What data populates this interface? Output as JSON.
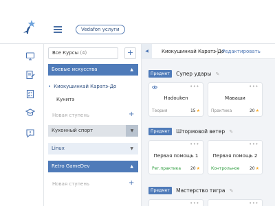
{
  "header": {
    "service_button": "Vedafon услуги"
  },
  "rail": {
    "icons": [
      "monitor-icon",
      "edit-document-icon",
      "checklist-icon",
      "graduation-cap-icon",
      "alert-message-icon"
    ]
  },
  "courses": {
    "search_label": "Все Курсы",
    "search_count": "(4)",
    "add_label": "+",
    "groups": [
      {
        "label": "Боевые искусства",
        "state": "active",
        "chevron": "▲"
      },
      {
        "label": "Кухонный спорт",
        "state": "grey",
        "chevron": "▼"
      },
      {
        "label": "Linux",
        "state": "light",
        "chevron": "▼"
      },
      {
        "label": "Retro GameDev",
        "state": "active",
        "chevron": "▲"
      }
    ],
    "sub_items": [
      "Киокушинкай Каратэ-До",
      "Кунитэ"
    ],
    "new_step": "Новая ступень"
  },
  "panel": {
    "back_chevron": "◀",
    "title": "Киокушинкай Каратэ-До",
    "edit": "Редактировать",
    "tag_label": "Предмет",
    "subjects": [
      {
        "name": "Супер удары",
        "cards": [
          {
            "name": "Hadouken",
            "type": "Теория",
            "score": "15",
            "type_color": "grey",
            "eye": true
          },
          {
            "name": "Маваши",
            "type": "Практика",
            "score": "20",
            "type_color": "grey",
            "eye": false
          }
        ]
      },
      {
        "name": "Штормовой ветер",
        "cards": [
          {
            "name": "Первая помощь 1",
            "type": "Рег.практика",
            "score": "20",
            "type_color": "green",
            "eye": false
          },
          {
            "name": "Первая помощь 2",
            "type": "Контрольное",
            "score": "20",
            "type_color": "green",
            "eye": false
          }
        ]
      },
      {
        "name": "Мастерство тигра",
        "cards": []
      }
    ],
    "dots": "•••",
    "star": "★",
    "pencil": "✎"
  },
  "colors": {
    "accent": "#4f7bb9",
    "green": "#2e9c3e",
    "star": "#f5a623"
  }
}
